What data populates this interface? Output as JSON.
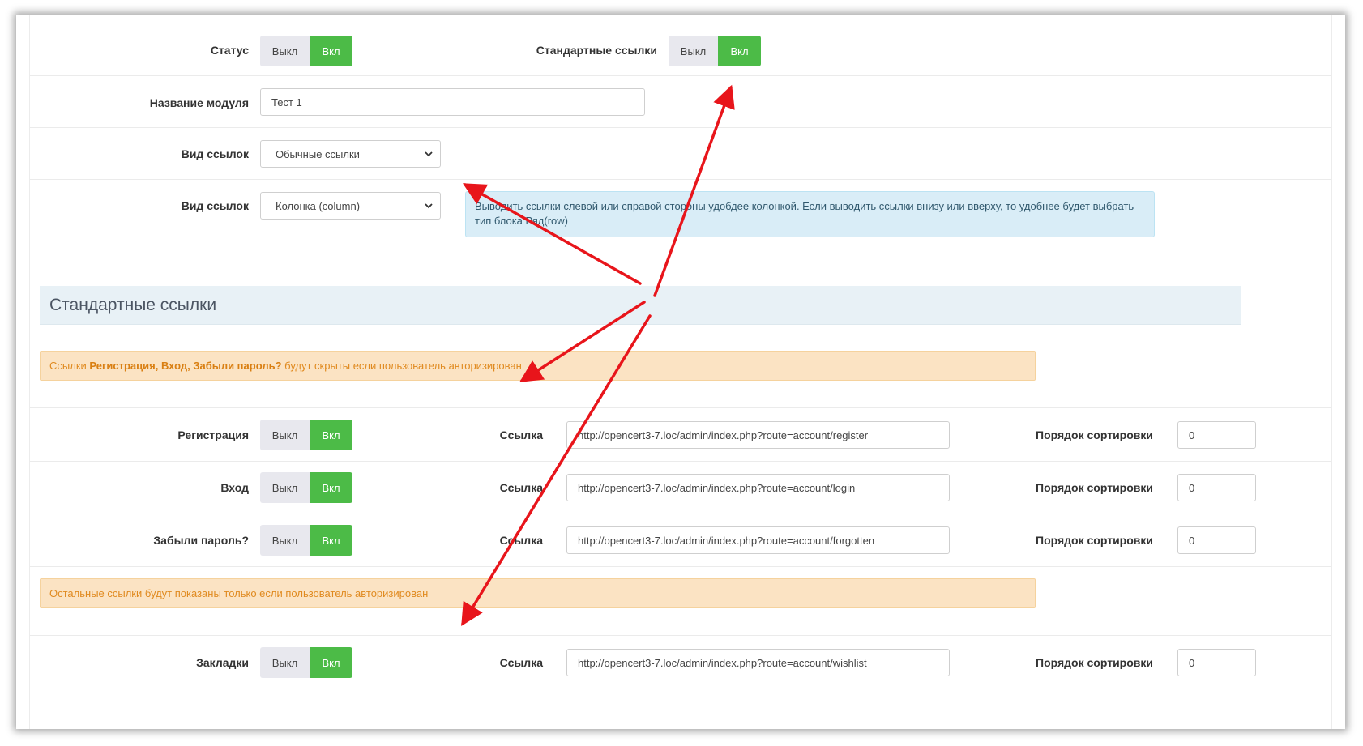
{
  "toggle": {
    "off_label": "Выкл",
    "on_label": "Вкл"
  },
  "status": {
    "label": "Статус"
  },
  "standard_links_toggle": {
    "label": "Стандартные ссылки"
  },
  "module_name": {
    "label": "Название модуля",
    "value": "Тест 1"
  },
  "link_view": {
    "label": "Вид ссылок",
    "selected": "Обычные ссылки"
  },
  "link_layout": {
    "label": "Вид ссылок",
    "selected": "Колонка (column)"
  },
  "layout_hint": "Выводить ссылки слевой или справой стороны удобдее колонкой. Если выводить ссылки внизу или вверху, то удобнее будет выбрать тип блока Ряд(row)",
  "section": {
    "title": "Стандартные ссылки"
  },
  "notice_1": {
    "prefix": "Ссылки ",
    "bold": "Регистрация, Вход, Забыли пароль?",
    "suffix": " будут скрыты если пользователь авторизирован"
  },
  "notice_2": "Остальные ссылки будут показаны только если пользователь авторизирован",
  "link_label": "Ссылка",
  "sort_label": "Порядок сортировки",
  "links": [
    {
      "name": "Регистрация",
      "url": "http://opencert3-7.loc/admin/index.php?route=account/register",
      "sort": "0"
    },
    {
      "name": "Вход",
      "url": "http://opencert3-7.loc/admin/index.php?route=account/login",
      "sort": "0"
    },
    {
      "name": "Забыли пароль?",
      "url": "http://opencert3-7.loc/admin/index.php?route=account/forgotten",
      "sort": "0"
    },
    {
      "name": "Закладки",
      "url": "http://opencert3-7.loc/admin/index.php?route=account/wishlist",
      "sort": "0"
    }
  ],
  "colors": {
    "accent_green": "#4cbb47",
    "annotation_red": "#e8151b",
    "warning_text": "#e08a1f"
  }
}
